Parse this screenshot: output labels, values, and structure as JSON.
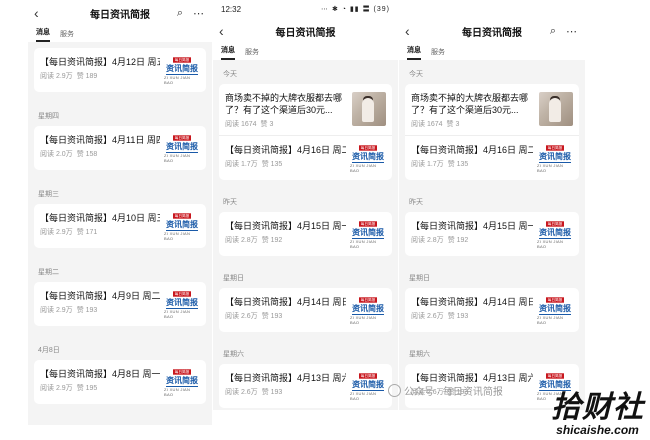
{
  "common": {
    "title": "每日资讯简报",
    "tabs": [
      "消息",
      "服务"
    ],
    "logo": {
      "top": "每日简报",
      "main": "资讯简报",
      "sub": "ZI XUN JIAN BAO"
    }
  },
  "p1": {
    "groups": [
      {
        "day": "",
        "items": [
          {
            "title": "【每日资讯简报】4月12日 周五",
            "reads": "阅读 2.9万",
            "likes": "赞 189"
          }
        ]
      },
      {
        "day": "星期四",
        "items": [
          {
            "title": "【每日资讯简报】4月11日 周四",
            "reads": "阅读 2.0万",
            "likes": "赞 158"
          }
        ]
      },
      {
        "day": "星期三",
        "items": [
          {
            "title": "【每日资讯简报】4月10日 周三",
            "reads": "阅读 2.9万",
            "likes": "赞 171"
          }
        ]
      },
      {
        "day": "星期二",
        "items": [
          {
            "title": "【每日资讯简报】4月9日 周二",
            "reads": "阅读 2.9万",
            "likes": "赞 193"
          }
        ]
      },
      {
        "day": "4月8日",
        "items": [
          {
            "title": "【每日资讯简报】4月8日 周一",
            "reads": "阅读 2.9万",
            "likes": "赞 195"
          }
        ]
      }
    ]
  },
  "p2": {
    "status": {
      "time": "12:32",
      "icons": "⋯ ✱ ◔ ▮▮ 〓 (39)"
    },
    "top": {
      "day": "今天",
      "title": "商场卖不掉的大牌衣服都去哪了？有了这个渠道后30元...",
      "reads": "阅读 1674",
      "likes": "赞 3",
      "title2": "【每日资讯简报】4月16日 周二",
      "reads2": "阅读 1.7万",
      "likes2": "赞 135"
    },
    "groups": [
      {
        "day": "昨天",
        "title": "【每日资讯简报】4月15日 周一",
        "reads": "阅读 2.8万",
        "likes": "赞 192"
      },
      {
        "day": "星期日",
        "title": "【每日资讯简报】4月14日 周日",
        "reads": "阅读 2.6万",
        "likes": "赞 193"
      },
      {
        "day": "星期六",
        "title": "【每日资讯简报】4月13日 周六",
        "reads": "阅读 2.6万",
        "likes": "赞 193"
      }
    ]
  },
  "p3": {
    "top": {
      "day": "今天",
      "title": "商场卖不掉的大牌衣服都去哪了？有了这个渠道后30元...",
      "reads": "阅读 1674",
      "likes": "赞 3",
      "title2": "【每日资讯简报】4月16日 周二",
      "reads2": "阅读 1.7万",
      "likes2": "赞 135"
    },
    "groups": [
      {
        "day": "昨天",
        "title": "【每日资讯简报】4月15日 周一",
        "reads": "阅读 2.8万",
        "likes": "赞 192"
      },
      {
        "day": "星期日",
        "title": "【每日资讯简报】4月14日 周日",
        "reads": "阅读 2.6万",
        "likes": "赞 193"
      },
      {
        "day": "星期六",
        "title": "【每日资讯简报】4月13日 周六",
        "reads": "阅读 2.6万",
        "likes": "赞 193"
      }
    ]
  },
  "watermark": {
    "text": "公众号 · 每日资讯简报"
  },
  "corner_mark": {
    "cn": "拾财社",
    "en": "shicaishe.com"
  }
}
